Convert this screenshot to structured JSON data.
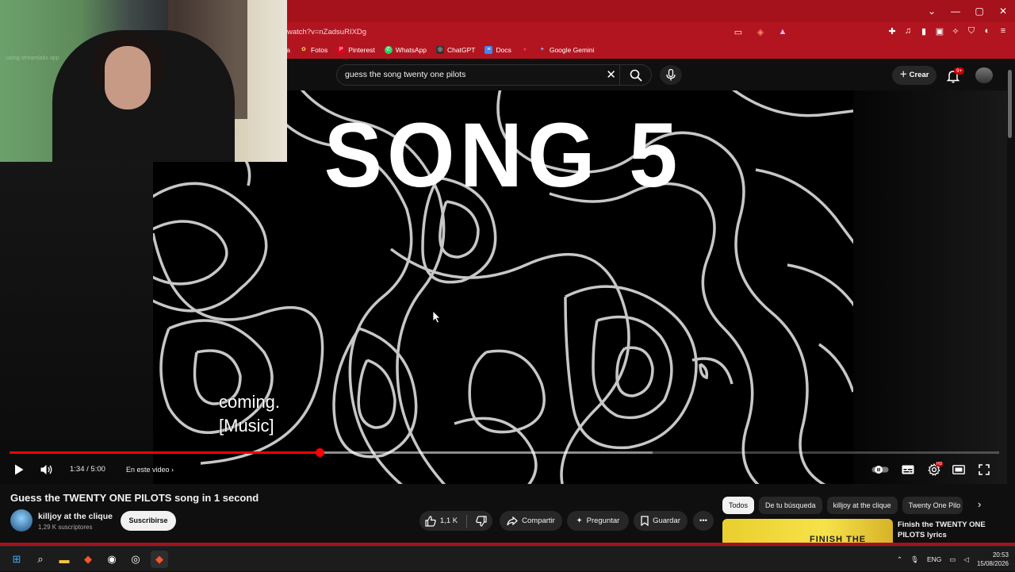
{
  "browser": {
    "url": "watch?v=nZadsuRIXDg",
    "window_controls": {
      "min": "—",
      "max": "▢",
      "close": "✕",
      "tabs": "⌄"
    },
    "bookmarks": [
      {
        "label": "va",
        "icon": ""
      },
      {
        "label": "Fotos",
        "icon": "✿"
      },
      {
        "label": "Pinterest",
        "icon": "P"
      },
      {
        "label": "WhatsApp",
        "icon": "✆"
      },
      {
        "label": "ChatGPT",
        "icon": "◎"
      },
      {
        "label": "Docs",
        "icon": "≡"
      },
      {
        "label": "",
        "icon": "●"
      },
      {
        "label": "Google Gemini",
        "icon": "✦"
      }
    ]
  },
  "youtube": {
    "search_query": "guess the song twenty one pilots",
    "create_label": "Crear",
    "notif_badge": "9+"
  },
  "webcam": {
    "watermark": "using streamlabs app"
  },
  "video": {
    "title_text": "SONG 5",
    "caption_line1": "coming.",
    "caption_line2": "[Music]",
    "time": "1:34 / 5:00",
    "chapter_label": "En este video",
    "progress_fraction": 0.313,
    "buffer_fraction": 0.65
  },
  "info": {
    "video_title": "Guess the TWENTY ONE PILOTS song in 1 second",
    "channel_name": "killjoy at the clique",
    "subscribers": "1,29 K suscriptores",
    "subscribe_label": "Suscribirse",
    "likes": "1,1 K",
    "share_label": "Compartir",
    "ask_label": "Preguntar",
    "save_label": "Guardar"
  },
  "sidebar": {
    "chips": [
      "Todos",
      "De tu búsqueda",
      "killjoy at the clique",
      "Twenty One Pilo"
    ],
    "rec_title": "Finish the TWENTY ONE PILOTS lyrics",
    "rec_thumb_text": "FINISH THE"
  },
  "taskbar": {
    "lang": "ENG",
    "time": "20:53",
    "date": "15/08/2026"
  }
}
